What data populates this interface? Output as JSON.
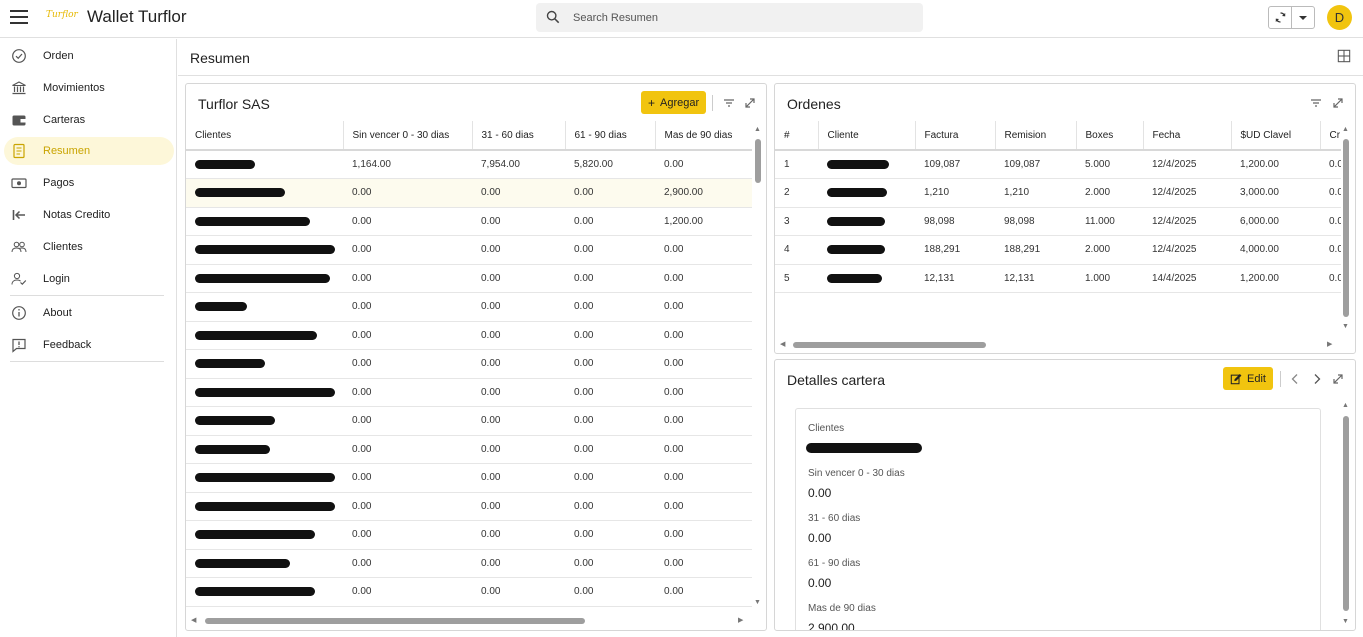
{
  "app": {
    "logo_text": "Turflor",
    "title": "Wallet Turflor",
    "avatar_initial": "D"
  },
  "search": {
    "placeholder": "Search Resumen"
  },
  "sidebar": {
    "items": [
      {
        "label": "Orden",
        "icon": "check-circle-icon"
      },
      {
        "label": "Movimientos",
        "icon": "bank-icon"
      },
      {
        "label": "Carteras",
        "icon": "wallet-icon"
      },
      {
        "label": "Resumen",
        "icon": "document-icon",
        "active": true
      },
      {
        "label": "Pagos",
        "icon": "cash-icon"
      },
      {
        "label": "Notas Credito",
        "icon": "arrow-left-bar-icon"
      },
      {
        "label": "Clientes",
        "icon": "users-icon"
      },
      {
        "label": "Login",
        "icon": "user-check-icon"
      },
      {
        "label": "About",
        "icon": "info-icon"
      },
      {
        "label": "Feedback",
        "icon": "feedback-icon"
      }
    ]
  },
  "main": {
    "title": "Resumen"
  },
  "left_panel": {
    "title": "Turflor SAS",
    "add_label": "Agregar",
    "columns": [
      "Clientes",
      "Sin vencer 0 - 30 dias",
      "31 - 60 dias",
      "61 - 90 dias",
      "Mas de 90 dias"
    ],
    "rows": [
      [
        "1,164.00",
        "7,954.00",
        "5,820.00",
        "0.00"
      ],
      [
        "0.00",
        "0.00",
        "0.00",
        "2,900.00"
      ],
      [
        "0.00",
        "0.00",
        "0.00",
        "1,200.00"
      ],
      [
        "0.00",
        "0.00",
        "0.00",
        "0.00"
      ],
      [
        "0.00",
        "0.00",
        "0.00",
        "0.00"
      ],
      [
        "0.00",
        "0.00",
        "0.00",
        "0.00"
      ],
      [
        "0.00",
        "0.00",
        "0.00",
        "0.00"
      ],
      [
        "0.00",
        "0.00",
        "0.00",
        "0.00"
      ],
      [
        "0.00",
        "0.00",
        "0.00",
        "0.00"
      ],
      [
        "0.00",
        "0.00",
        "0.00",
        "0.00"
      ],
      [
        "0.00",
        "0.00",
        "0.00",
        "0.00"
      ],
      [
        "0.00",
        "0.00",
        "0.00",
        "0.00"
      ],
      [
        "0.00",
        "0.00",
        "0.00",
        "0.00"
      ],
      [
        "0.00",
        "0.00",
        "0.00",
        "0.00"
      ],
      [
        "0.00",
        "0.00",
        "0.00",
        "0.00"
      ],
      [
        "0.00",
        "0.00",
        "0.00",
        "0.00"
      ]
    ]
  },
  "orders_panel": {
    "title": "Ordenes",
    "columns": [
      "#",
      "Cliente",
      "Factura",
      "Remision",
      "Boxes",
      "Fecha",
      "$UD Clavel",
      "Cr"
    ],
    "rows": [
      [
        "1",
        "109,087",
        "109,087",
        "5.000",
        "12/4/2025",
        "1,200.00",
        "0.0"
      ],
      [
        "2",
        "1,210",
        "1,210",
        "2.000",
        "12/4/2025",
        "3,000.00",
        "0.0"
      ],
      [
        "3",
        "98,098",
        "98,098",
        "11.000",
        "12/4/2025",
        "6,000.00",
        "0.0"
      ],
      [
        "4",
        "188,291",
        "188,291",
        "2.000",
        "12/4/2025",
        "4,000.00",
        "0.0"
      ],
      [
        "5",
        "12,131",
        "12,131",
        "1.000",
        "14/4/2025",
        "1,200.00",
        "0.0"
      ]
    ]
  },
  "detail_panel": {
    "title": "Detalles cartera",
    "edit_label": "Edit",
    "fields": [
      {
        "label": "Clientes",
        "value": ""
      },
      {
        "label": "Sin vencer 0 - 30 dias",
        "value": "0.00"
      },
      {
        "label": "31 - 60 dias",
        "value": "0.00"
      },
      {
        "label": "61 - 90 dias",
        "value": "0.00"
      },
      {
        "label": "Mas de 90 dias",
        "value": "2,900.00"
      }
    ]
  }
}
